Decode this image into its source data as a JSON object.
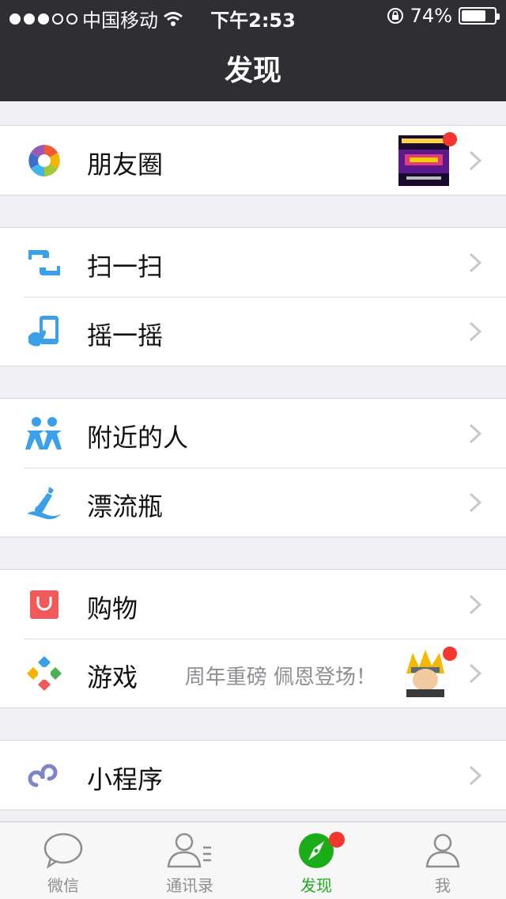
{
  "status_bar": {
    "carrier": "中国移动",
    "time": "下午2:53",
    "battery": "74%",
    "battery_level": 0.74
  },
  "nav": {
    "title": "发现"
  },
  "groups": [
    {
      "items": [
        {
          "label": "朋友圈",
          "icon": "moments-icon",
          "has_thumb": true,
          "badge": true
        }
      ]
    },
    {
      "items": [
        {
          "label": "扫一扫",
          "icon": "scan-icon"
        },
        {
          "label": "摇一摇",
          "icon": "shake-icon"
        }
      ]
    },
    {
      "items": [
        {
          "label": "附近的人",
          "icon": "people-nearby-icon"
        },
        {
          "label": "漂流瓶",
          "icon": "drift-bottle-icon"
        }
      ]
    },
    {
      "items": [
        {
          "label": "购物",
          "icon": "shopping-icon"
        },
        {
          "label": "游戏",
          "icon": "games-icon",
          "subtext": "周年重磅 佩恩登场！",
          "has_thumb": true,
          "badge": true
        }
      ]
    },
    {
      "items": [
        {
          "label": "小程序",
          "icon": "mini-program-icon"
        }
      ]
    }
  ],
  "tabbar": {
    "tabs": [
      {
        "label": "微信",
        "icon": "chat-bubble-icon",
        "active": false
      },
      {
        "label": "通讯录",
        "icon": "contacts-icon",
        "active": false
      },
      {
        "label": "发现",
        "icon": "compass-icon",
        "active": true,
        "badge": true
      },
      {
        "label": "我",
        "icon": "profile-icon",
        "active": false
      }
    ]
  },
  "colors": {
    "nav_bg": "#2f2e33",
    "accent": "#1aad19",
    "badge": "#f43530",
    "background": "#efeff4"
  }
}
